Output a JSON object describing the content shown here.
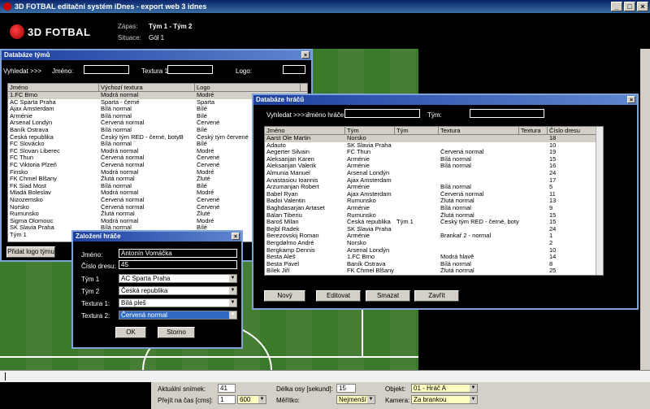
{
  "window": {
    "title": "3D FOTBAL editační systém iDnes - export web 3 idnes"
  },
  "header": {
    "logo_text": "3D FOTBAL",
    "match_label": "Zápas:",
    "match_value": "Tým 1 - Tým 2",
    "situation_label": "Situace:",
    "situation_value": "Gól 1"
  },
  "teams_window": {
    "title": "Databáze týmů",
    "search_label": "Vyhledat >>>",
    "name_label": "Jméno:",
    "texture_label": "Textura 1:",
    "logo_label": "Logo:",
    "columns": [
      "Jméno",
      "Výchozí textura",
      "Logo"
    ],
    "rows": [
      [
        "1.FC Brno",
        "Modrá normal",
        "Modré"
      ],
      [
        "AC Sparta Praha",
        "Sparta - černé",
        "Sparta"
      ],
      [
        "Ajax Amsterdam",
        "Bílá normal",
        "Bílé"
      ],
      [
        "Arménie",
        "Bílá normal",
        "Bílé"
      ],
      [
        "Arsenal Londýn",
        "Červená normal",
        "Červené"
      ],
      [
        "Baník Ostrava",
        "Bílá normal",
        "Bílé"
      ],
      [
        "Česká republika",
        "Český tým RED - černé, botyB",
        "Český tým červené"
      ],
      [
        "FC Slovácko",
        "Bílá normal",
        "Bílé"
      ],
      [
        "FC Slovan Liberec",
        "Modrá normal",
        "Modré"
      ],
      [
        "FC Thun",
        "Červená normal",
        "Červené"
      ],
      [
        "FC Viktoria Plzeň",
        "Červená normal",
        "Červené"
      ],
      [
        "Finsko",
        "Modrá normal",
        "Modré"
      ],
      [
        "FK Chmel Blšany",
        "Žlutá normal",
        "Žluté"
      ],
      [
        "FK Siad Most",
        "Bílá normal",
        "Bílé"
      ],
      [
        "Mladá Boleslav",
        "Modrá normal",
        "Modré"
      ],
      [
        "Nizozemsko",
        "Červená normal",
        "Červené"
      ],
      [
        "Norsko",
        "Červená normal",
        "Červené"
      ],
      [
        "Rumunsko",
        "Žlutá normal",
        "Žluté"
      ],
      [
        "Sigma Olomouc",
        "Modrá normal",
        "Modré"
      ],
      [
        "SK Slavia Praha",
        "Bílá normal",
        "Bílé"
      ],
      [
        "Tým 1",
        "",
        ""
      ]
    ],
    "add_logo_button": "Přidat logo týmu"
  },
  "players_window": {
    "title": "Databáze hráčů",
    "search_label": "Vyhledat >>>>",
    "name_label": "Jméno hráče:",
    "team_label": "Tým:",
    "columns": [
      "Jméno",
      "Tým",
      "Tým",
      "Textura",
      "Textura",
      "Číslo dresu"
    ],
    "rows": [
      [
        "Aarst Ole Martin",
        "Norsko",
        "",
        "",
        "",
        "18"
      ],
      [
        "Adauto",
        "SK Slavia Praha",
        "",
        "",
        "",
        "10"
      ],
      [
        "Aegerter Silvain",
        "FC Thun",
        "",
        "Červená normal",
        "",
        "19"
      ],
      [
        "Aleksanjan Karen",
        "Arménie",
        "",
        "Bílá normal",
        "",
        "15"
      ],
      [
        "Aleksanjan Valerik",
        "Arménie",
        "",
        "Bílá normal",
        "",
        "16"
      ],
      [
        "Almunia Manuel",
        "Arsenal Londýn",
        "",
        "",
        "",
        "24"
      ],
      [
        "Anastasiou Ioannis",
        "Ajax Amsterdam",
        "",
        "",
        "",
        "17"
      ],
      [
        "Arzumanjan Robert",
        "Arménie",
        "",
        "Bílá normal",
        "",
        "5"
      ],
      [
        "Babel Ryan",
        "Ajax Amsterdam",
        "",
        "Červená normal",
        "",
        "11"
      ],
      [
        "Badoi Valentin",
        "Rumunsko",
        "",
        "Žlutá normal",
        "",
        "13"
      ],
      [
        "Baghdasarjan Artaset",
        "Arménie",
        "",
        "Bílá normal",
        "",
        "9"
      ],
      [
        "Balan Tiberiu",
        "Rumunsko",
        "",
        "Žlutá normal",
        "",
        "15"
      ],
      [
        "Baroš Milan",
        "Česká republika",
        "Tým 1",
        "Český tým RED - černé, botyB",
        "",
        "15"
      ],
      [
        "Bejbl Radek",
        "SK Slavia Praha",
        "",
        "",
        "",
        "24"
      ],
      [
        "Berezovskij Roman",
        "Arménie",
        "",
        "Brankař 2 - normal",
        "",
        "1"
      ],
      [
        "Bergdølmo André",
        "Norsko",
        "",
        "",
        "",
        "2"
      ],
      [
        "Bergkamp Dennis",
        "Arsenal Londýn",
        "",
        "",
        "",
        "10"
      ],
      [
        "Besta Aleš",
        "1.FC Brno",
        "",
        "Modrá hlavě",
        "",
        "14"
      ],
      [
        "Besta Pavel",
        "Baník Ostrava",
        "",
        "Bílá normal",
        "",
        "8"
      ],
      [
        "Bílek Jiří",
        "FK Chmel Blšany",
        "",
        "Žlutá normal",
        "",
        "25"
      ]
    ],
    "buttons": {
      "new": "Nový",
      "edit": "Editovat",
      "delete": "Smazat",
      "close": "Zavřít"
    }
  },
  "create_player": {
    "title": "Založení hráče",
    "name_label": "Jméno:",
    "name_value": "Antonín Vomáčka",
    "jersey_label": "Číslo dresu:",
    "jersey_value": "45",
    "team1_label": "Tým 1",
    "team1_value": "AC Sparta Praha",
    "team2_label": "Tým 2",
    "team2_value": "Česká republika",
    "texture1_label": "Textura 1:",
    "texture1_value": "Bílá pleš",
    "texture2_label": "Textura 2:",
    "texture2_value": "Červená normal",
    "ok_button": "OK",
    "cancel_button": "Storno"
  },
  "bottom_bar": {
    "current_frame_label": "Aktuální snímek:",
    "current_frame_value": "41",
    "goto_time_label": "Přejít na čas [cms]:",
    "goto_time_value": "1",
    "goto_time_select": "600",
    "axis_length_label": "Délka osy [sekund]:",
    "axis_length_value": "15",
    "scale_label": "Měřítko:",
    "scale_value": "Nejmenší",
    "object_label": "Objekt:",
    "object_value": "01 - Hráč A",
    "camera_label": "Kamera:",
    "camera_value": "Za brankou"
  },
  "colors": {
    "titlebar": "#0a246a",
    "window_border": "#7ea3d8",
    "pitch_green": "#3c7a2b",
    "selection": "#316ac5"
  }
}
